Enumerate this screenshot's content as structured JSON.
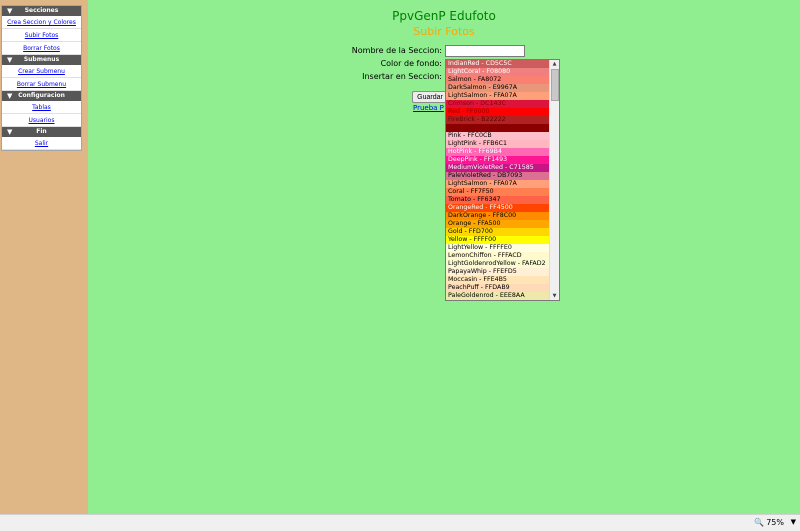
{
  "sidebar": {
    "sections": [
      {
        "header": "Secciones",
        "items": [
          "Crea Seccion y Colores",
          "Subir Fotos",
          "Borrar Fotos"
        ]
      },
      {
        "header": "Submenus",
        "items": [
          "Crear Submenu",
          "Borrar Submenu"
        ]
      },
      {
        "header": "Configuracion",
        "items": [
          "Tablas",
          "Usuarios"
        ]
      },
      {
        "header": "Fin",
        "items": [
          "Salir"
        ]
      }
    ]
  },
  "page": {
    "title": "PpvGenP Edufoto",
    "subtitle": "Subir Fotos"
  },
  "form": {
    "name_label": "Nombre de la Seccion:",
    "name_value": "",
    "color_label": "Color de fondo:",
    "insert_label": "Insertar en Seccion:",
    "save_label": "Guardar",
    "link_label": "Prueba P"
  },
  "colors": {
    "page_bg": "#90EE90",
    "sidebar_bg": "#DFB787",
    "title": "#008000",
    "subtitle": "#FFA500"
  },
  "color_options": [
    {
      "label": "IndianRed - CD5C5C",
      "bg": "#CD5C5C",
      "fg": "#ffffff"
    },
    {
      "label": "LightCoral - F08080",
      "bg": "#F08080",
      "fg": "#ffffff"
    },
    {
      "label": "Salmon - FA8072",
      "bg": "#FA8072",
      "fg": "#000000"
    },
    {
      "label": "DarkSalmon - E9967A",
      "bg": "#E9967A",
      "fg": "#000000"
    },
    {
      "label": "LightSalmon - FFA07A",
      "bg": "#FFA07A",
      "fg": "#000000"
    },
    {
      "label": "Crimson - DC143C",
      "bg": "#DC143C",
      "fg": "#8b0000"
    },
    {
      "label": "Red - FF0000",
      "bg": "#FF0000",
      "fg": "#8b0000"
    },
    {
      "label": "FireBrick - B22222",
      "bg": "#B22222",
      "fg": "#6e0000"
    },
    {
      "label": "",
      "bg": "#8B0000",
      "fg": "#8b0000"
    },
    {
      "label": "Pink - FFC0CB",
      "bg": "#FFC0CB",
      "fg": "#000000"
    },
    {
      "label": "LightPink - FFB6C1",
      "bg": "#FFB6C1",
      "fg": "#000000"
    },
    {
      "label": "HotPink - FF69B4",
      "bg": "#FF69B4",
      "fg": "#ffffff"
    },
    {
      "label": "DeepPink - FF1493",
      "bg": "#FF1493",
      "fg": "#ffffff"
    },
    {
      "label": "MediumVioletRed - C71585",
      "bg": "#C71585",
      "fg": "#ffffff"
    },
    {
      "label": "PaleVioletRed - DB7093",
      "bg": "#DB7093",
      "fg": "#000000"
    },
    {
      "label": "LightSalmon - FFA07A",
      "bg": "#FFA07A",
      "fg": "#000000"
    },
    {
      "label": "Coral - FF7F50",
      "bg": "#FF7F50",
      "fg": "#000000"
    },
    {
      "label": "Tomato - FF6347",
      "bg": "#FF6347",
      "fg": "#000000"
    },
    {
      "label": "OrangeRed - FF4500",
      "bg": "#FF4500",
      "fg": "#ffffff"
    },
    {
      "label": "DarkOrange - FF8C00",
      "bg": "#FF8C00",
      "fg": "#000000"
    },
    {
      "label": "Orange - FFA500",
      "bg": "#FFA500",
      "fg": "#000000"
    },
    {
      "label": "Gold - FFD700",
      "bg": "#FFD700",
      "fg": "#000000"
    },
    {
      "label": "Yellow - FFFF00",
      "bg": "#FFFF00",
      "fg": "#000000"
    },
    {
      "label": "LightYellow - FFFFE0",
      "bg": "#FFFFE0",
      "fg": "#000000"
    },
    {
      "label": "LemonChiffon - FFFACD",
      "bg": "#FFFACD",
      "fg": "#000000"
    },
    {
      "label": "LightGoldenrodYellow - FAFAD2",
      "bg": "#FAFAD2",
      "fg": "#000000"
    },
    {
      "label": "PapayaWhip - FFEFD5",
      "bg": "#FFEFD5",
      "fg": "#000000"
    },
    {
      "label": "Moccasin - FFE4B5",
      "bg": "#FFE4B5",
      "fg": "#000000"
    },
    {
      "label": "PeachPuff - FFDAB9",
      "bg": "#FFDAB9",
      "fg": "#000000"
    },
    {
      "label": "PaleGoldenrod - EEE8AA",
      "bg": "#EEE8AA",
      "fg": "#000000"
    }
  ],
  "statusbar": {
    "zoom": "75%",
    "zoom_icon": "magnifier-icon",
    "caret_icon": "chevron-down-icon"
  }
}
